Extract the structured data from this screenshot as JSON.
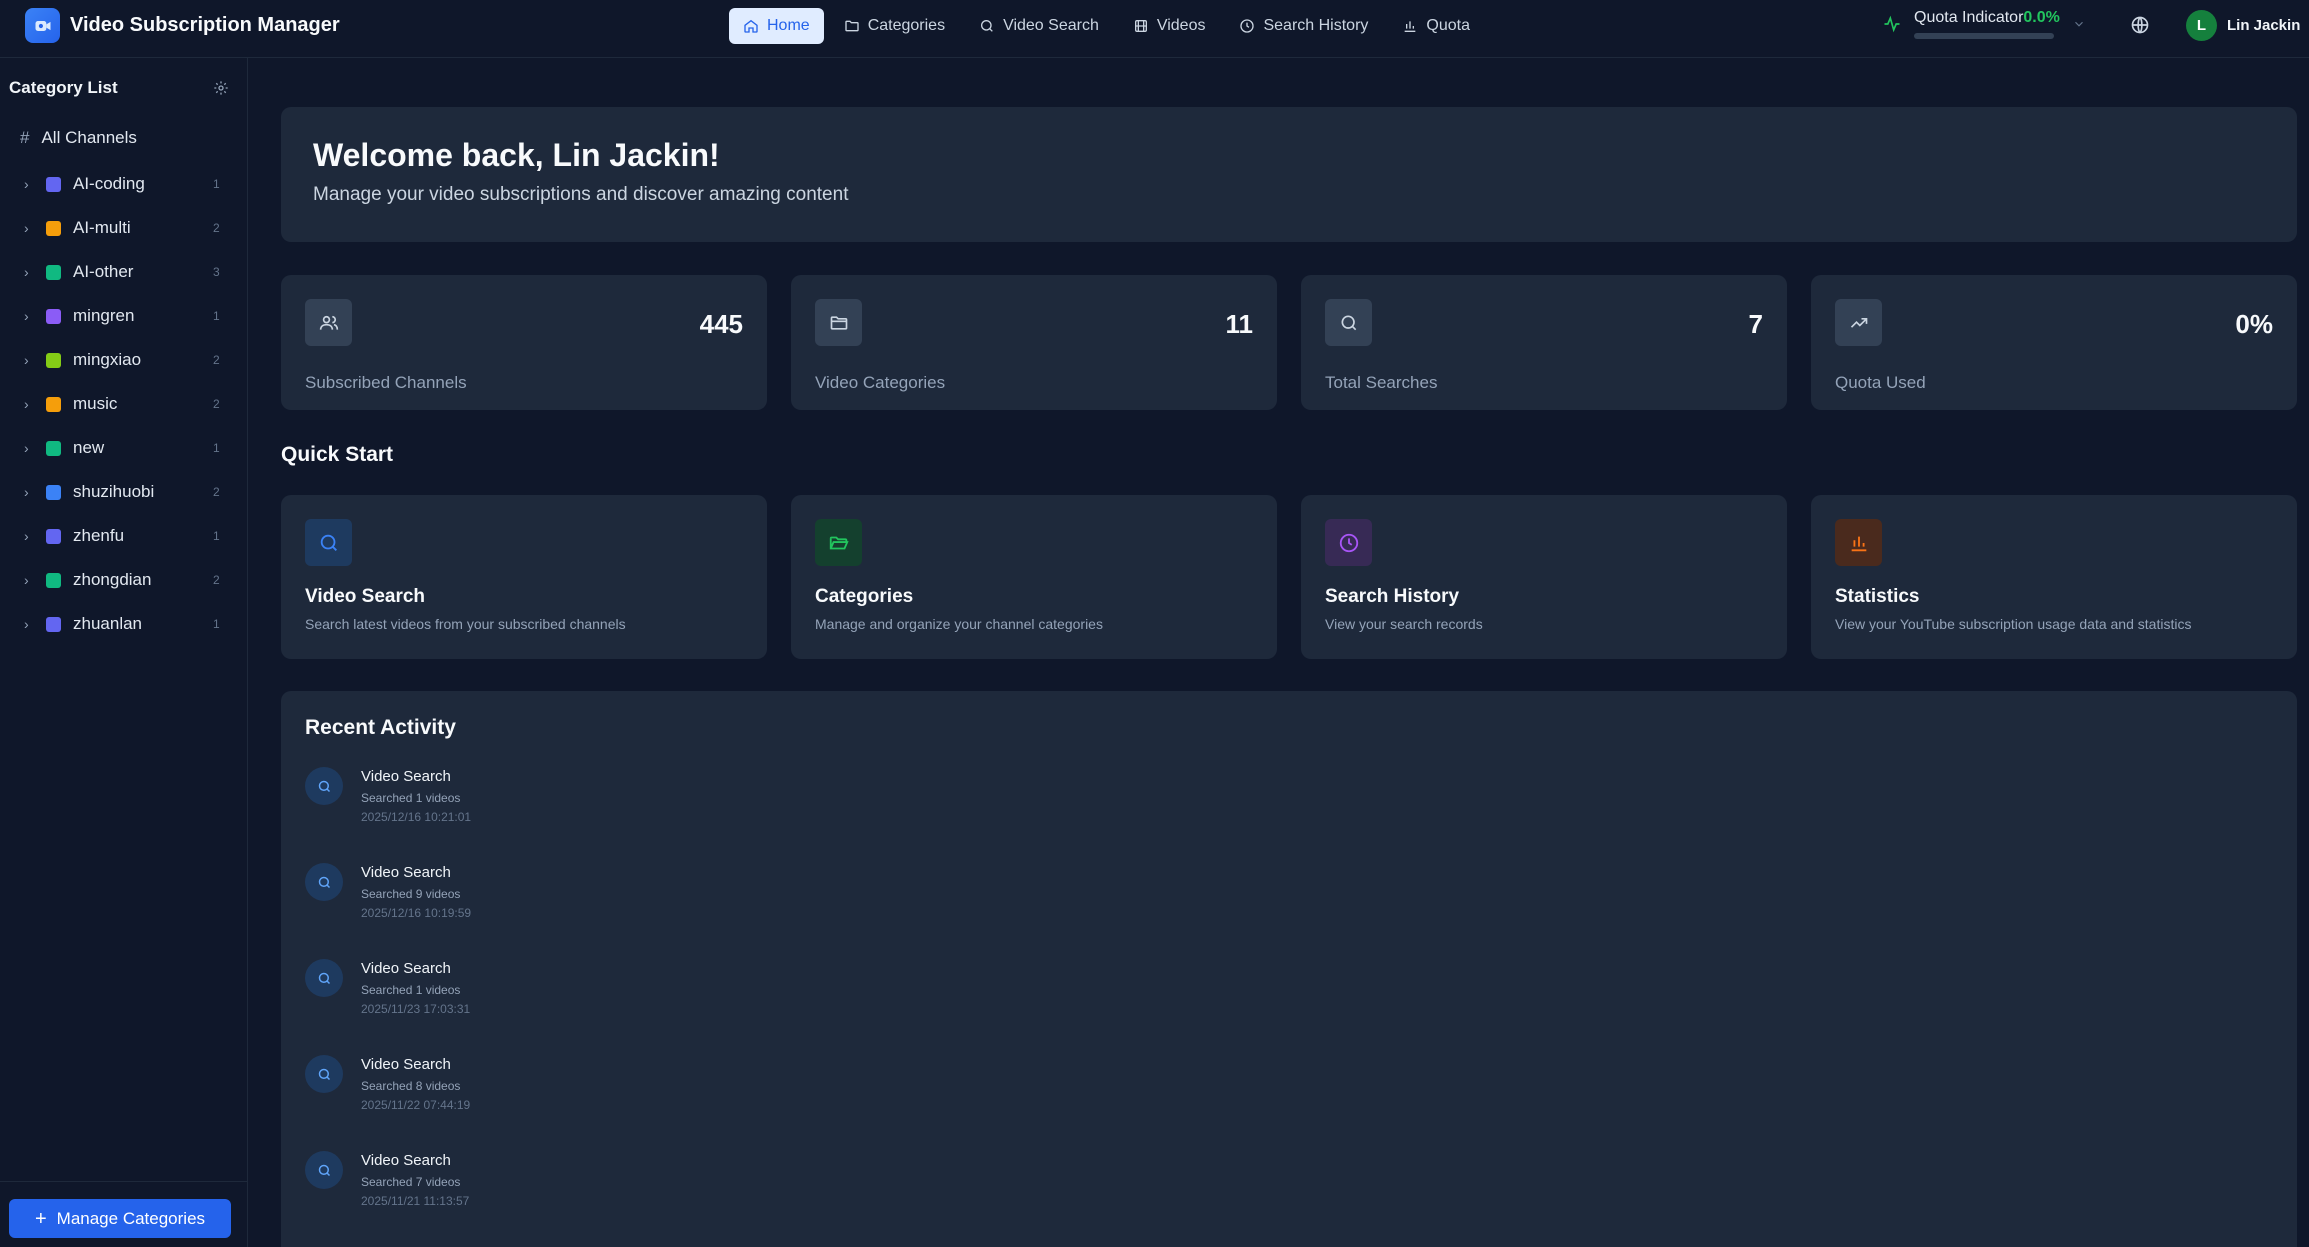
{
  "app": {
    "title": "Video Subscription Manager",
    "brand_color": "#3b82f6"
  },
  "nav": {
    "items": [
      {
        "label": "Home",
        "icon": "home-icon",
        "active": true
      },
      {
        "label": "Categories",
        "icon": "folder-icon"
      },
      {
        "label": "Video Search",
        "icon": "search-icon"
      },
      {
        "label": "Videos",
        "icon": "film-icon"
      },
      {
        "label": "Search History",
        "icon": "clock-icon"
      },
      {
        "label": "Quota",
        "icon": "bar-chart-icon"
      }
    ]
  },
  "header": {
    "quota_label": "Quota Indicator",
    "quota_value": "0.0%",
    "quota_fraction": 0.0,
    "user_initial": "L",
    "user_name": "Lin Jackin"
  },
  "sidebar": {
    "title": "Category List",
    "all_label": "All Channels",
    "categories": [
      {
        "name": "AI-coding",
        "count": "1",
        "color": "#6366f1"
      },
      {
        "name": "AI-multi",
        "count": "2",
        "color": "#f59e0b"
      },
      {
        "name": "AI-other",
        "count": "3",
        "color": "#10b981"
      },
      {
        "name": "mingren",
        "count": "1",
        "color": "#8b5cf6"
      },
      {
        "name": "mingxiao",
        "count": "2",
        "color": "#84cc16"
      },
      {
        "name": "music",
        "count": "2",
        "color": "#f59e0b"
      },
      {
        "name": "new",
        "count": "1",
        "color": "#10b981"
      },
      {
        "name": "shuzihuobi",
        "count": "2",
        "color": "#3b82f6"
      },
      {
        "name": "zhenfu",
        "count": "1",
        "color": "#6366f1"
      },
      {
        "name": "zhongdian",
        "count": "2",
        "color": "#10b981"
      },
      {
        "name": "zhuanlan",
        "count": "1",
        "color": "#6366f1"
      }
    ],
    "manage_label": "Manage Categories"
  },
  "welcome": {
    "title": "Welcome back, Lin Jackin!",
    "subtitle": "Manage your video subscriptions and discover amazing content"
  },
  "stats": [
    {
      "value": "445",
      "label": "Subscribed Channels",
      "icon": "users-icon"
    },
    {
      "value": "11",
      "label": "Video Categories",
      "icon": "folder-icon"
    },
    {
      "value": "7",
      "label": "Total Searches",
      "icon": "search-icon"
    },
    {
      "value": "0%",
      "label": "Quota Used",
      "icon": "trending-up-icon"
    }
  ],
  "quick_start": {
    "title": "Quick Start",
    "items": [
      {
        "title": "Video Search",
        "desc": "Search latest videos from your subscribed channels",
        "icon": "search-icon",
        "color": "#3b82f6"
      },
      {
        "title": "Categories",
        "desc": "Manage and organize your channel categories",
        "icon": "folder-open-icon",
        "color": "#22c55e"
      },
      {
        "title": "Search History",
        "desc": "View your search records",
        "icon": "clock-icon",
        "color": "#a855f7"
      },
      {
        "title": "Statistics",
        "desc": "View your YouTube subscription usage data and statistics",
        "icon": "bar-chart-icon",
        "color": "#f97316"
      }
    ]
  },
  "activity": {
    "title": "Recent Activity",
    "items": [
      {
        "title": "Video Search",
        "desc": "Searched 1 videos",
        "time": "2025/12/16 10:21:01"
      },
      {
        "title": "Video Search",
        "desc": "Searched 9 videos",
        "time": "2025/12/16 10:19:59"
      },
      {
        "title": "Video Search",
        "desc": "Searched 1 videos",
        "time": "2025/11/23 17:03:31"
      },
      {
        "title": "Video Search",
        "desc": "Searched 8 videos",
        "time": "2025/11/22 07:44:19"
      },
      {
        "title": "Video Search",
        "desc": "Searched 7 videos",
        "time": "2025/11/21 11:13:57"
      }
    ]
  }
}
